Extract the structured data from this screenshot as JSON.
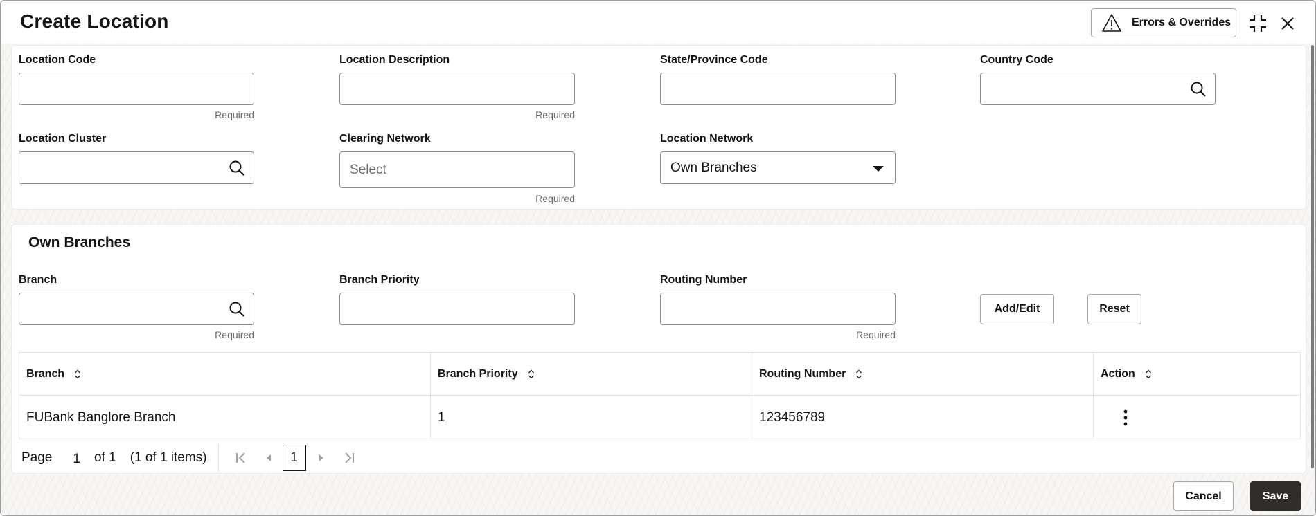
{
  "header": {
    "title": "Create Location",
    "errors_button": "Errors & Overrides",
    "icons": {
      "warning": "warning-triangle-icon",
      "collapse": "collapse-icon",
      "close": "close-icon"
    }
  },
  "location_form": {
    "location_code": {
      "label": "Location Code",
      "value": "",
      "hint": "Required"
    },
    "location_description": {
      "label": "Location Description",
      "value": "",
      "hint": "Required"
    },
    "state_province_code": {
      "label": "State/Province Code",
      "value": ""
    },
    "country_code": {
      "label": "Country Code",
      "value": ""
    },
    "location_cluster": {
      "label": "Location Cluster",
      "value": ""
    },
    "clearing_network": {
      "label": "Clearing Network",
      "placeholder": "Select",
      "hint": "Required"
    },
    "location_network": {
      "label": "Location Network",
      "value": "Own Branches"
    }
  },
  "own_branches": {
    "title": "Own Branches",
    "branch": {
      "label": "Branch",
      "value": "",
      "hint": "Required"
    },
    "branch_priority": {
      "label": "Branch Priority",
      "value": ""
    },
    "routing_number": {
      "label": "Routing Number",
      "value": "",
      "hint": "Required"
    },
    "add_edit_button": "Add/Edit",
    "reset_button": "Reset",
    "table": {
      "columns": [
        "Branch",
        "Branch Priority",
        "Routing Number",
        "Action"
      ],
      "rows": [
        {
          "branch": "FUBank Banglore Branch",
          "priority": "1",
          "routing_number": "123456789"
        }
      ]
    },
    "pagination": {
      "page_label": "Page",
      "page_input": "1",
      "of_label": "of 1",
      "items_label": "(1 of 1 items)",
      "current_page": "1"
    }
  },
  "footer": {
    "cancel": "Cancel",
    "save": "Save"
  },
  "colors": {
    "primary_button": "#312d2a",
    "text": "#161513",
    "muted": "#6f6c69",
    "border": "#8e8c89"
  }
}
